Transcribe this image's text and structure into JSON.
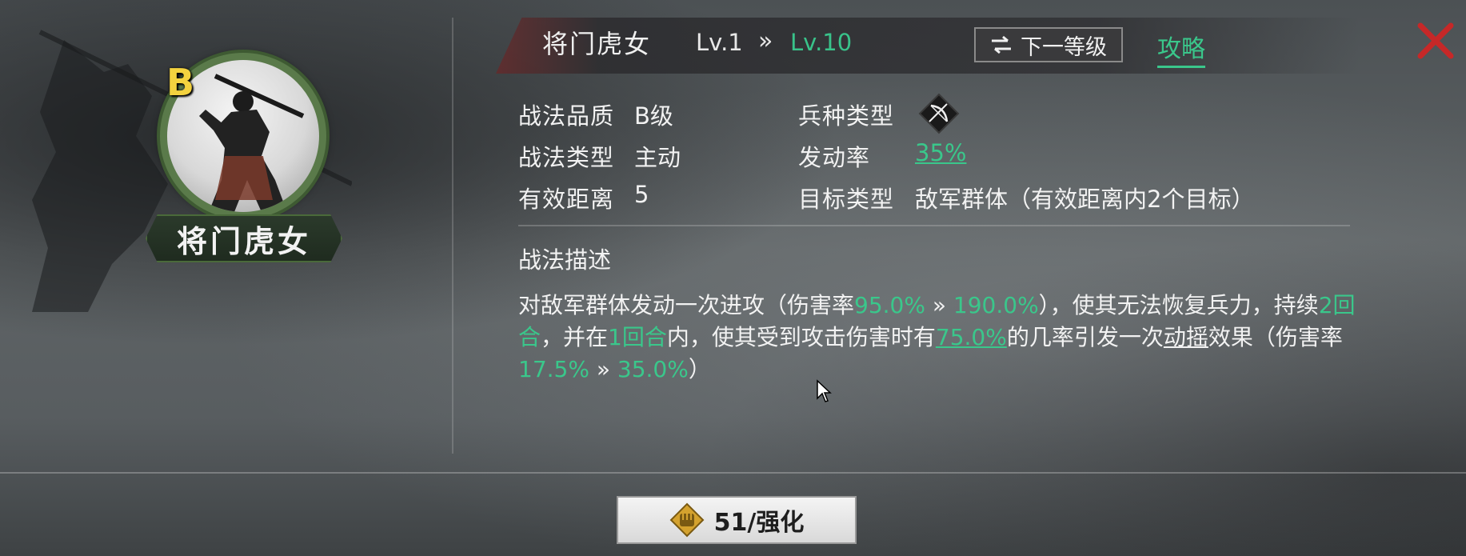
{
  "portrait": {
    "grade": "B",
    "name": "将门虎女"
  },
  "header": {
    "title": "将门虎女",
    "level_from": "Lv.1",
    "level_arrow": "»",
    "level_to": "Lv.10",
    "next_level_label": "下一等级",
    "guide_label": "攻略"
  },
  "attributes": {
    "quality_label": "战法品质",
    "quality_value": "B级",
    "type_label": "战法类型",
    "type_value": "主动",
    "range_label": "有效距离",
    "range_value": "5",
    "troop_label": "兵种类型",
    "troop_icon": "bow-icon",
    "rate_label": "发动率",
    "rate_value": "35%",
    "target_label": "目标类型",
    "target_value": "敌军群体（有效距离内2个目标）"
  },
  "description": {
    "title": "战法描述",
    "t1": "对敌军群体发动一次进攻（伤害率",
    "g1": "95.0%",
    "a1": " » ",
    "g2": "190.0%",
    "t2": "），使其无法恢复兵力，持续",
    "g3": "2回合",
    "t3": "，并在",
    "g4": "1回合",
    "t4": "内，使其受到攻击伤害时有",
    "g5": "75.0%",
    "t5": "的几率引发一次",
    "u1": "动摇",
    "t6": "效果（伤害率",
    "g6": "17.5%",
    "a2": " » ",
    "g7": "35.0%",
    "t7": "）"
  },
  "enhance": {
    "label": "51/强化"
  },
  "colors": {
    "accent_green": "#3ac78b",
    "grade_gold": "#f3d23f",
    "close_red": "#c62828"
  }
}
